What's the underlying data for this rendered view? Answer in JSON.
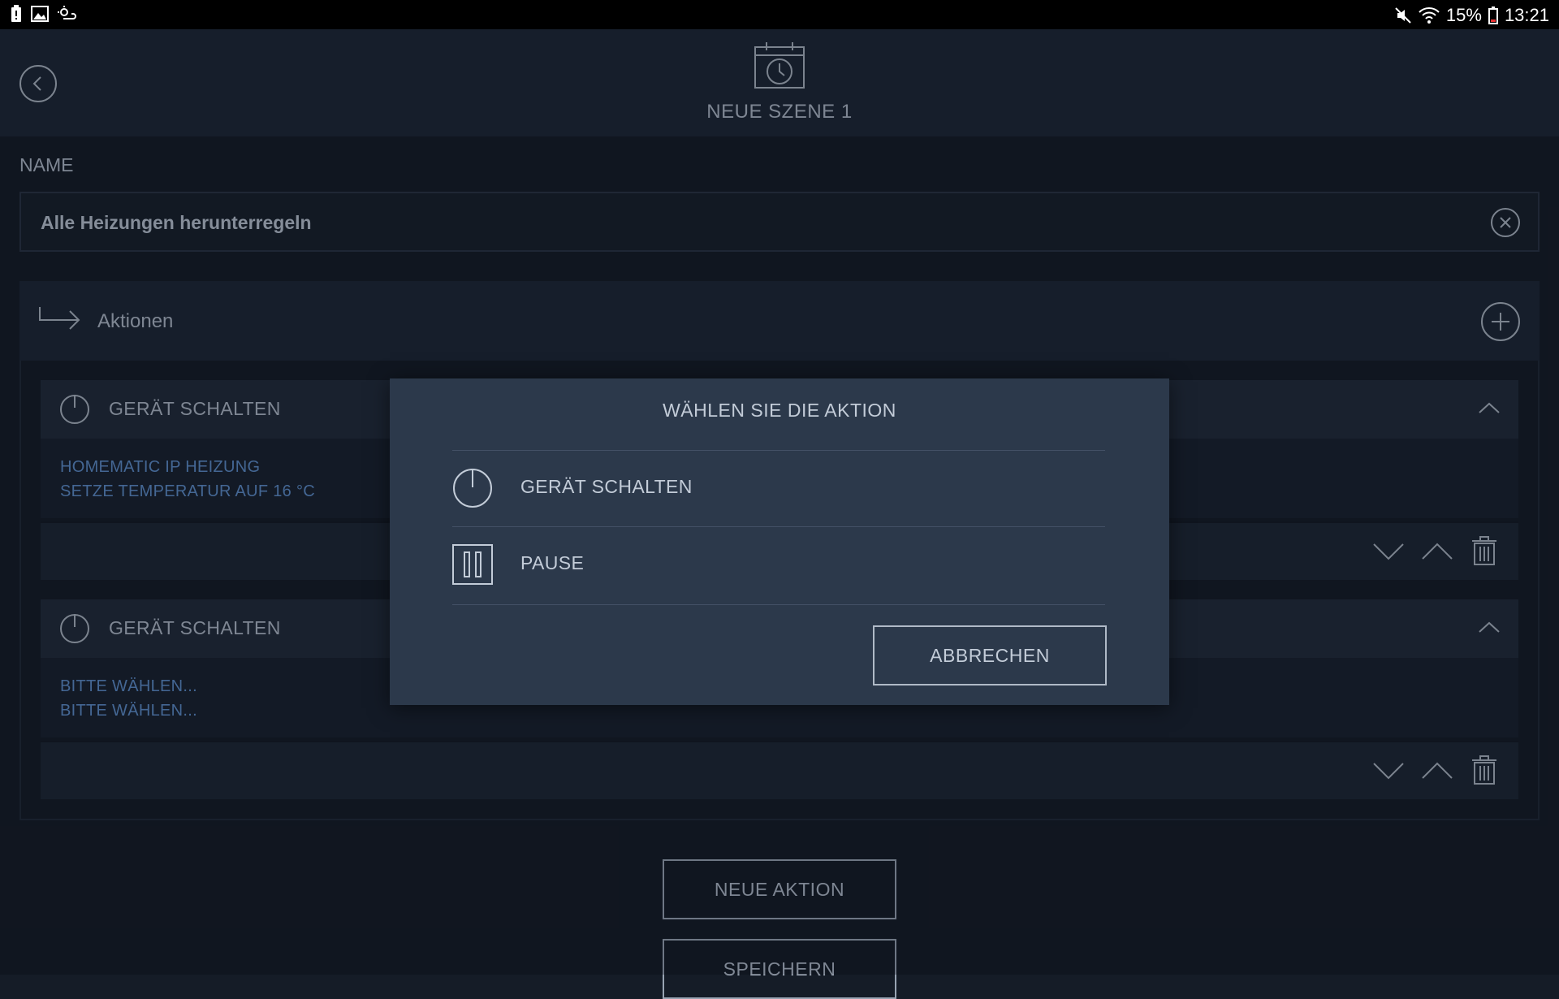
{
  "status_bar": {
    "left_icons": [
      "battery-alert-icon",
      "image-icon",
      "weather-icon"
    ],
    "battery_percent": "15%",
    "time": "13:21"
  },
  "header": {
    "title": "NEUE SZENE 1",
    "icon": "calendar-clock-icon"
  },
  "name_section": {
    "label": "NAME",
    "value": "Alle Heizungen herunterregeln"
  },
  "actions_section": {
    "label": "Aktionen"
  },
  "action_cards": [
    {
      "title": "GERÄT SCHALTEN",
      "line1": "HOMEMATIC IP HEIZUNG",
      "line2": "SETZE TEMPERATUR AUF 16 °C"
    },
    {
      "title": "GERÄT SCHALTEN",
      "line1": "BITTE WÄHLEN...",
      "line2": "BITTE WÄHLEN..."
    }
  ],
  "buttons": {
    "new_action": "NEUE AKTION",
    "save": "SPEICHERN"
  },
  "dialog": {
    "title": "WÄHLEN SIE DIE AKTION",
    "options": [
      {
        "label": "GERÄT SCHALTEN",
        "icon": "power-icon"
      },
      {
        "label": "PAUSE",
        "icon": "pause-icon"
      }
    ],
    "cancel": "ABBRECHEN"
  },
  "colors": {
    "background": "#151c27",
    "header": "#1e2836",
    "dialog": "#2c394b",
    "accent_text": "#5d8cc8"
  }
}
